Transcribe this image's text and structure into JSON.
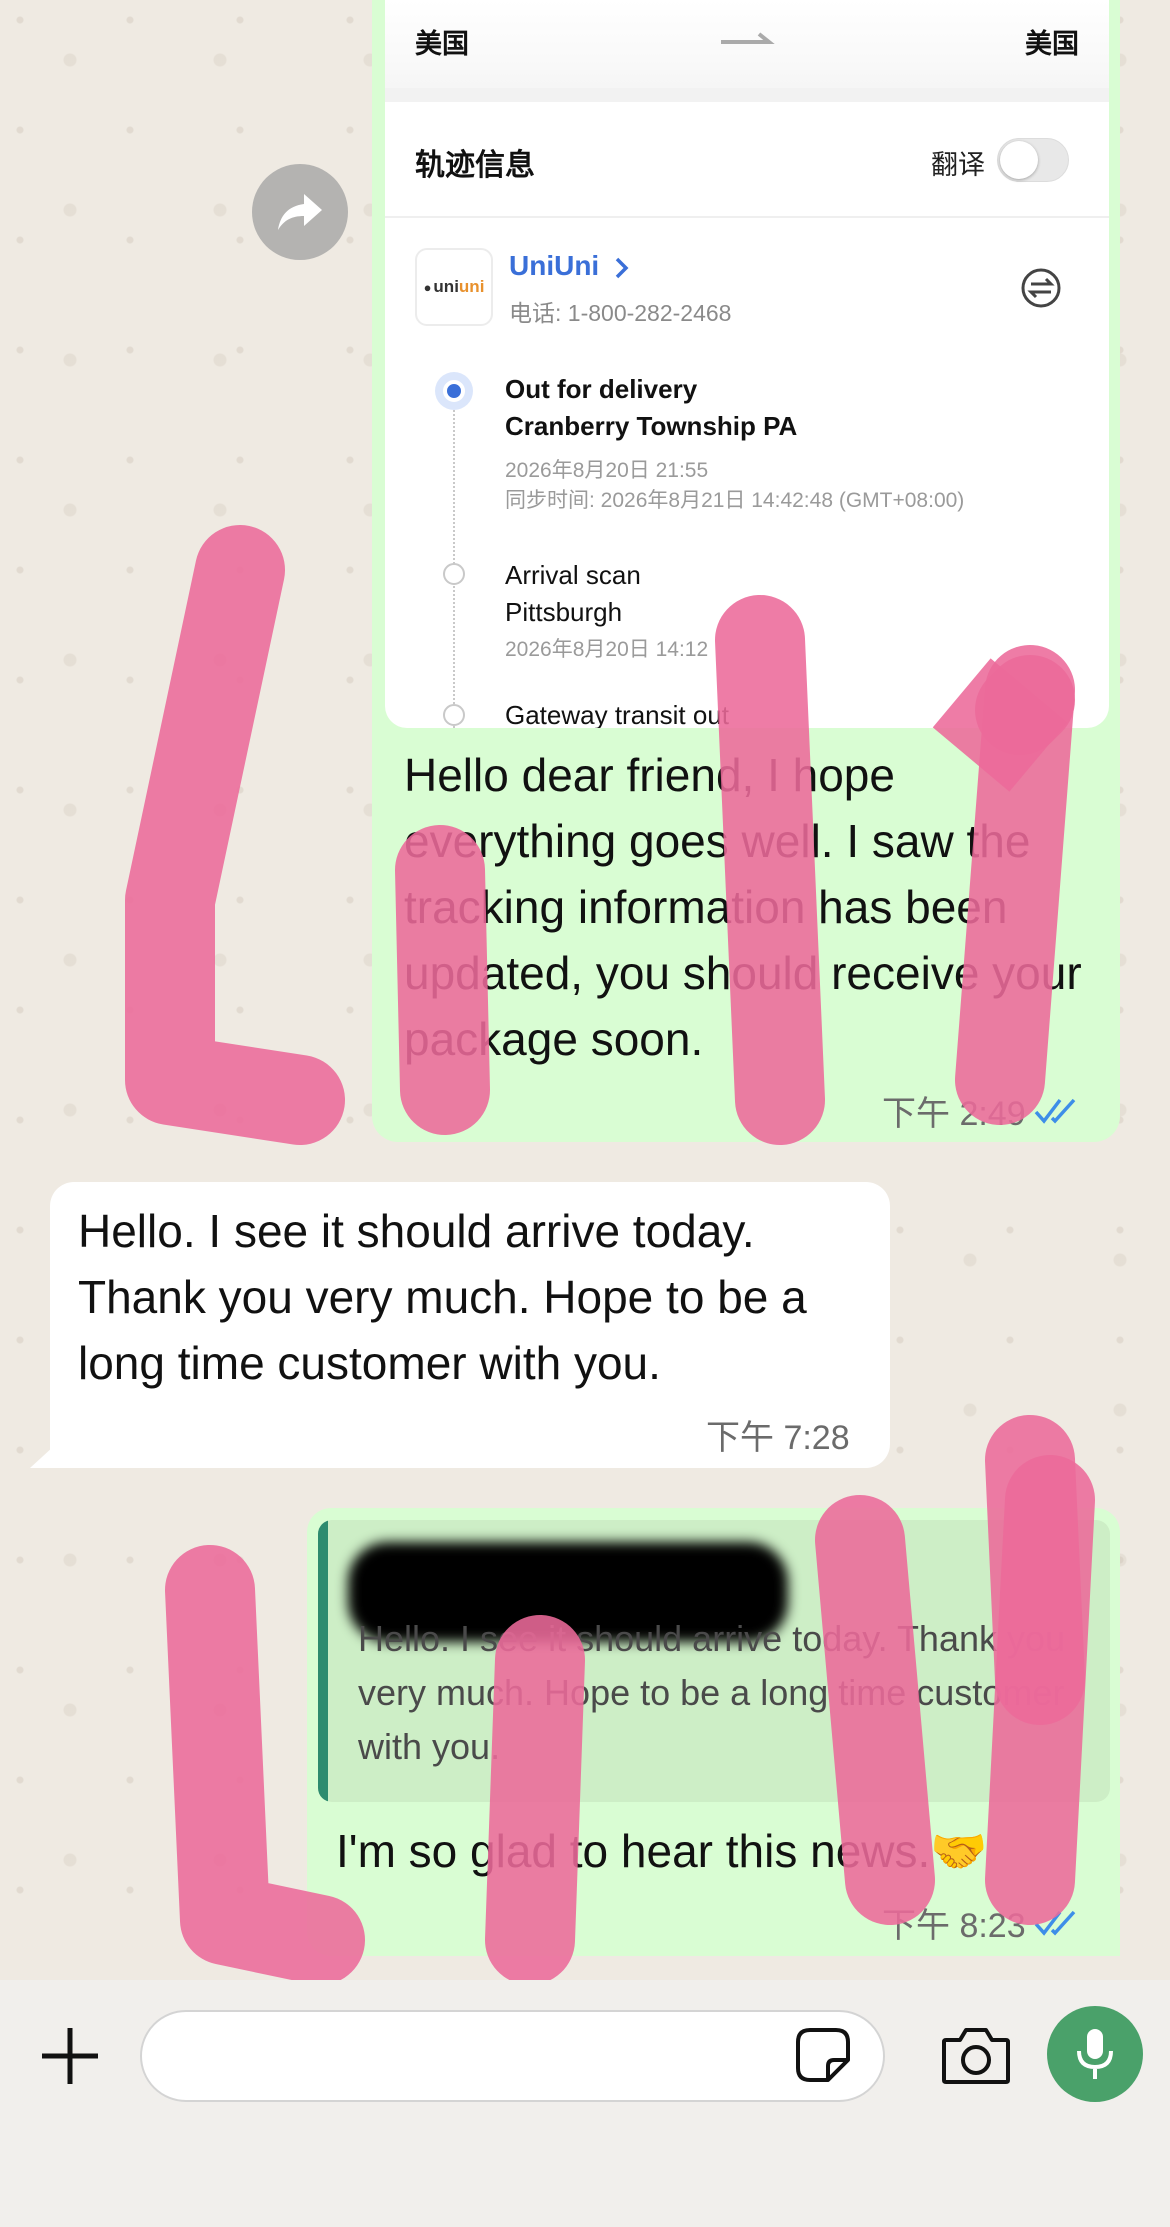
{
  "tracking_card": {
    "origin": "美国",
    "destination": "美国",
    "section_title": "轨迹信息",
    "translate_label": "翻译",
    "translate_on": false,
    "carrier": {
      "logo_text_1": "uni",
      "logo_text_2": "uni",
      "name": "UniUni",
      "phone": "电话: 1-800-282-2468"
    },
    "events": [
      {
        "status": "Out for delivery",
        "location": "Cranberry Township PA",
        "time": "2026年8月20日 21:55",
        "sync_time": "同步时间: 2026年8月21日 14:42:48 (GMT+08:00)"
      },
      {
        "status": "Arrival scan",
        "location": "Pittsburgh",
        "time": "2026年8月20日 14:12"
      },
      {
        "status": "Gateway transit out"
      }
    ]
  },
  "messages": [
    {
      "direction": "outgoing",
      "text": "Hello dear friend, I hope everything goes well. I saw the tracking information has been updated, you should receive your package soon.",
      "time": "下午 2:49",
      "status": "read"
    },
    {
      "direction": "incoming",
      "text": "Hello. I see it should arrive today. Thank you very much. Hope to be a long time customer with you.",
      "time": "下午 7:28"
    },
    {
      "direction": "outgoing",
      "quoted_text": "Hello. I see it should arrive today. Thank you very much. Hope to be a long time customer with you.",
      "text": "I'm so glad to hear this news.🤝",
      "time": "下午 8:23",
      "status": "read"
    }
  ],
  "composer": {
    "placeholder": "",
    "value": ""
  },
  "colors": {
    "outgoing_bubble": "#d9fdd3",
    "incoming_bubble": "#ffffff",
    "read_ticks": "#3d8ee8",
    "mic_button": "#4aa16a",
    "link_blue": "#3a6fd8"
  },
  "icons": [
    "forward-icon",
    "chevron-right-icon",
    "swap-icon",
    "double-check-icon",
    "plus-icon",
    "sticker-icon",
    "camera-icon",
    "microphone-icon"
  ]
}
